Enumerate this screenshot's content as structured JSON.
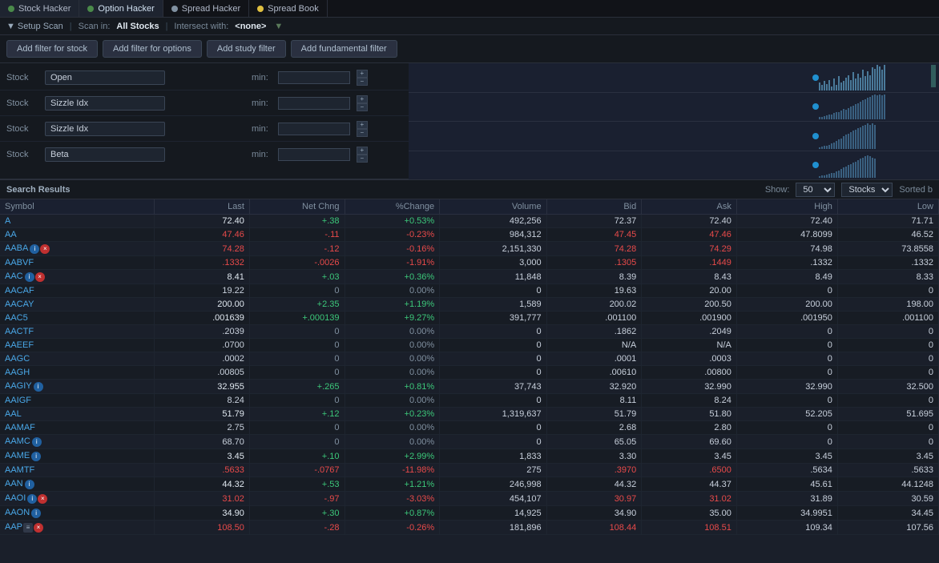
{
  "nav": {
    "tabs": [
      {
        "id": "stock-hacker",
        "label": "Stock Hacker",
        "dot_color": "#4a8a4a",
        "active": false
      },
      {
        "id": "option-hacker",
        "label": "Option Hacker",
        "dot_color": "#4a8a4a",
        "active": true
      },
      {
        "id": "spread-hacker",
        "label": "Spread Hacker",
        "dot_color": "#8090a0",
        "active": false
      },
      {
        "id": "spread-book",
        "label": "Spread Book",
        "dot_color": "#e0c040",
        "active": false
      }
    ]
  },
  "toolbar": {
    "setup_scan": "Setup Scan",
    "scan_in_label": "Scan in:",
    "scan_in_value": "All Stocks",
    "intersect_label": "Intersect with:",
    "intersect_value": "<none>"
  },
  "filter_buttons": [
    "Add filter for stock",
    "Add filter for options",
    "Add study filter",
    "Add fundamental filter"
  ],
  "filters": [
    {
      "label": "Stock",
      "select_value": "Open",
      "min_label": "min:"
    },
    {
      "label": "Stock",
      "select_value": "Sizzle Idx",
      "min_label": "min:"
    },
    {
      "label": "Stock",
      "select_value": "Sizzle Idx",
      "min_label": "min:"
    },
    {
      "label": "Stock",
      "select_value": "Beta",
      "min_label": "min:"
    }
  ],
  "results": {
    "title": "Search Results",
    "show_label": "Show:",
    "show_value": "50",
    "type_value": "Stocks",
    "sorted_label": "Sorted b"
  },
  "table": {
    "columns": [
      "Symbol",
      "Last",
      "Net Chng",
      "%Change",
      "Volume",
      "Bid",
      "Ask",
      "High",
      "Low"
    ],
    "rows": [
      {
        "symbol": "A",
        "last": "72.40",
        "net_chng": "+.38",
        "pct_chng": "+0.53%",
        "volume": "492,256",
        "bid": "72.37",
        "ask": "72.40",
        "high": "72.40",
        "low": "71.71",
        "chng_dir": "pos"
      },
      {
        "symbol": "AA",
        "last": "47.46",
        "net_chng": "-.11",
        "pct_chng": "-0.23%",
        "volume": "984,312",
        "bid": "47.45",
        "ask": "47.46",
        "high": "47.8099",
        "low": "46.52",
        "chng_dir": "neg"
      },
      {
        "symbol": "AABA",
        "last": "74.28",
        "net_chng": "-.12",
        "pct_chng": "-0.16%",
        "volume": "2,151,330",
        "bid": "74.28",
        "ask": "74.29",
        "high": "74.98",
        "low": "73.8558",
        "chng_dir": "neg",
        "icons": [
          "info",
          "cancel"
        ]
      },
      {
        "symbol": "AABVF",
        "last": ".1332",
        "net_chng": "-.0026",
        "pct_chng": "-1.91%",
        "volume": "3,000",
        "bid": ".1305",
        "ask": ".1449",
        "high": ".1332",
        "low": ".1332",
        "chng_dir": "neg"
      },
      {
        "symbol": "AAC",
        "last": "8.41",
        "net_chng": "+.03",
        "pct_chng": "+0.36%",
        "volume": "11,848",
        "bid": "8.39",
        "ask": "8.43",
        "high": "8.49",
        "low": "8.33",
        "chng_dir": "pos",
        "icons": [
          "info",
          "cancel"
        ]
      },
      {
        "symbol": "AACAF",
        "last": "19.22",
        "net_chng": "0",
        "pct_chng": "0.00%",
        "volume": "0",
        "bid": "19.63",
        "ask": "20.00",
        "high": "0",
        "low": "0",
        "chng_dir": "neutral"
      },
      {
        "symbol": "AACAY",
        "last": "200.00",
        "net_chng": "+2.35",
        "pct_chng": "+1.19%",
        "volume": "1,589",
        "bid": "200.02",
        "ask": "200.50",
        "high": "200.00",
        "low": "198.00",
        "chng_dir": "pos"
      },
      {
        "symbol": "AAC5",
        "last": ".001639",
        "net_chng": "+.000139",
        "pct_chng": "+9.27%",
        "volume": "391,777",
        "bid": ".001100",
        "ask": ".001900",
        "high": ".001950",
        "low": ".001100",
        "chng_dir": "pos"
      },
      {
        "symbol": "AACTF",
        "last": ".2039",
        "net_chng": "0",
        "pct_chng": "0.00%",
        "volume": "0",
        "bid": ".1862",
        "ask": ".2049",
        "high": "0",
        "low": "0",
        "chng_dir": "neutral"
      },
      {
        "symbol": "AAEEF",
        "last": ".0700",
        "net_chng": "0",
        "pct_chng": "0.00%",
        "volume": "0",
        "bid": "N/A",
        "ask": "N/A",
        "high": "0",
        "low": "0",
        "chng_dir": "neutral"
      },
      {
        "symbol": "AAGC",
        "last": ".0002",
        "net_chng": "0",
        "pct_chng": "0.00%",
        "volume": "0",
        "bid": ".0001",
        "ask": ".0003",
        "high": "0",
        "low": "0",
        "chng_dir": "neutral"
      },
      {
        "symbol": "AAGH",
        "last": ".00805",
        "net_chng": "0",
        "pct_chng": "0.00%",
        "volume": "0",
        "bid": ".00610",
        "ask": ".00800",
        "high": "0",
        "low": "0",
        "chng_dir": "neutral"
      },
      {
        "symbol": "AAGIY",
        "last": "32.955",
        "net_chng": "+.265",
        "pct_chng": "+0.81%",
        "volume": "37,743",
        "bid": "32.920",
        "ask": "32.990",
        "high": "32.990",
        "low": "32.500",
        "chng_dir": "pos",
        "icons": [
          "info"
        ]
      },
      {
        "symbol": "AAIGF",
        "last": "8.24",
        "net_chng": "0",
        "pct_chng": "0.00%",
        "volume": "0",
        "bid": "8.11",
        "ask": "8.24",
        "high": "0",
        "low": "0",
        "chng_dir": "neutral"
      },
      {
        "symbol": "AAL",
        "last": "51.79",
        "net_chng": "+.12",
        "pct_chng": "+0.23%",
        "volume": "1,319,637",
        "bid": "51.79",
        "ask": "51.80",
        "high": "52.205",
        "low": "51.695",
        "chng_dir": "pos"
      },
      {
        "symbol": "AAMAF",
        "last": "2.75",
        "net_chng": "0",
        "pct_chng": "0.00%",
        "volume": "0",
        "bid": "2.68",
        "ask": "2.80",
        "high": "0",
        "low": "0",
        "chng_dir": "neutral"
      },
      {
        "symbol": "AAMC",
        "last": "68.70",
        "net_chng": "0",
        "pct_chng": "0.00%",
        "volume": "0",
        "bid": "65.05",
        "ask": "69.60",
        "high": "0",
        "low": "0",
        "chng_dir": "neutral",
        "icons": [
          "info"
        ]
      },
      {
        "symbol": "AAME",
        "last": "3.45",
        "net_chng": "+.10",
        "pct_chng": "+2.99%",
        "volume": "1,833",
        "bid": "3.30",
        "ask": "3.45",
        "high": "3.45",
        "low": "3.45",
        "chng_dir": "pos",
        "icons": [
          "info"
        ]
      },
      {
        "symbol": "AAMTF",
        "last": ".5633",
        "net_chng": "-.0767",
        "pct_chng": "-11.98%",
        "volume": "275",
        "bid": ".3970",
        "ask": ".6500",
        "high": ".5634",
        "low": ".5633",
        "chng_dir": "neg"
      },
      {
        "symbol": "AAN",
        "last": "44.32",
        "net_chng": "+.53",
        "pct_chng": "+1.21%",
        "volume": "246,998",
        "bid": "44.32",
        "ask": "44.37",
        "high": "45.61",
        "low": "44.1248",
        "chng_dir": "pos",
        "icons": [
          "info"
        ]
      },
      {
        "symbol": "AAOI",
        "last": "31.02",
        "net_chng": "-.97",
        "pct_chng": "-3.03%",
        "volume": "454,107",
        "bid": "30.97",
        "ask": "31.02",
        "high": "31.89",
        "low": "30.59",
        "chng_dir": "neg",
        "icons": [
          "info",
          "cancel"
        ]
      },
      {
        "symbol": "AAON",
        "last": "34.90",
        "net_chng": "+.30",
        "pct_chng": "+0.87%",
        "volume": "14,925",
        "bid": "34.90",
        "ask": "35.00",
        "high": "34.9951",
        "low": "34.45",
        "chng_dir": "pos",
        "icons": [
          "info"
        ]
      },
      {
        "symbol": "AAP",
        "last": "108.50",
        "net_chng": "-.28",
        "pct_chng": "-0.26%",
        "volume": "181,896",
        "bid": "108.44",
        "ask": "108.51",
        "high": "109.34",
        "low": "107.56",
        "chng_dir": "neg",
        "icons": [
          "tiny",
          "cancel"
        ]
      }
    ]
  }
}
